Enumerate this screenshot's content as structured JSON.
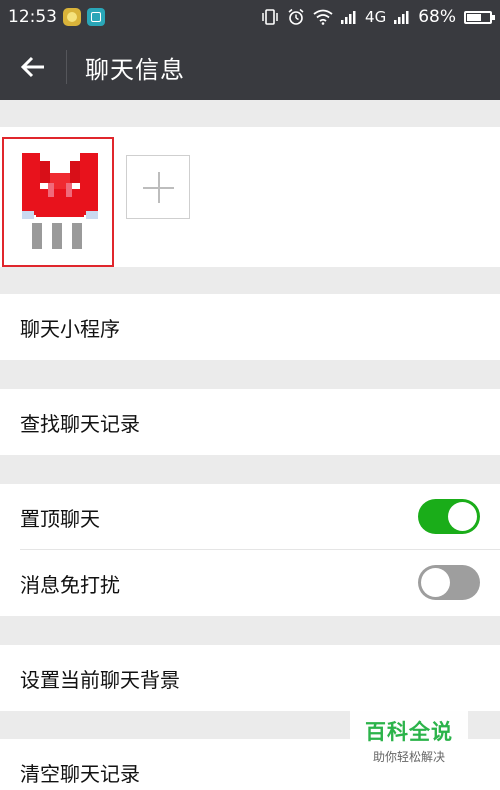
{
  "statusbar": {
    "time": "12:53",
    "network": "4G",
    "battery_text": "68%",
    "battery_level": 0.68
  },
  "header": {
    "title": "聊天信息"
  },
  "rows": {
    "mini_program": "聊天小程序",
    "search_history": "查找聊天记录",
    "pin_chat": "置顶聊天",
    "pin_chat_enabled": true,
    "mute": "消息免打扰",
    "mute_enabled": false,
    "set_background": "设置当前聊天背景",
    "clear_history": "清空聊天记录"
  },
  "watermark": {
    "title": "百科全说",
    "subtitle": "助你轻松解决"
  },
  "colors": {
    "header_bg": "#393a3f",
    "accent_green": "#1aad19",
    "toggle_off": "#9e9e9e",
    "highlight_red": "#e0262c"
  }
}
